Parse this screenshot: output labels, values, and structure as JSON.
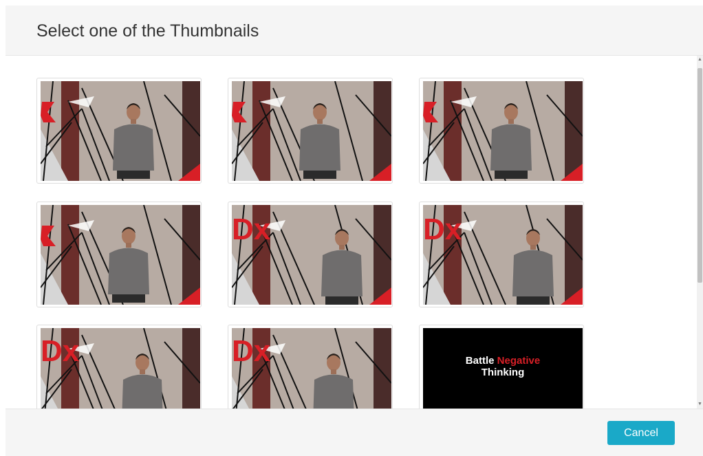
{
  "dialog": {
    "title": "Select one of the Thumbnails",
    "cancel_label": "Cancel"
  },
  "thumbnails": [
    {
      "kind": "speaker",
      "pose": "hands-center"
    },
    {
      "kind": "speaker",
      "pose": "hands-low"
    },
    {
      "kind": "speaker",
      "pose": "hands-low"
    },
    {
      "kind": "speaker",
      "pose": "hands-low"
    },
    {
      "kind": "speaker",
      "pose": "facing-right"
    },
    {
      "kind": "speaker",
      "pose": "facing-right"
    },
    {
      "kind": "speaker",
      "pose": "hand-raised"
    },
    {
      "kind": "speaker",
      "pose": "hand-raised"
    },
    {
      "kind": "title-card",
      "line1_white": "Battle",
      "line1_red": "Negative",
      "line2": "Thinking"
    }
  ],
  "colors": {
    "accent": "#1aa9c8",
    "header_bg": "#f5f5f5",
    "stage_red": "#d81f26"
  }
}
